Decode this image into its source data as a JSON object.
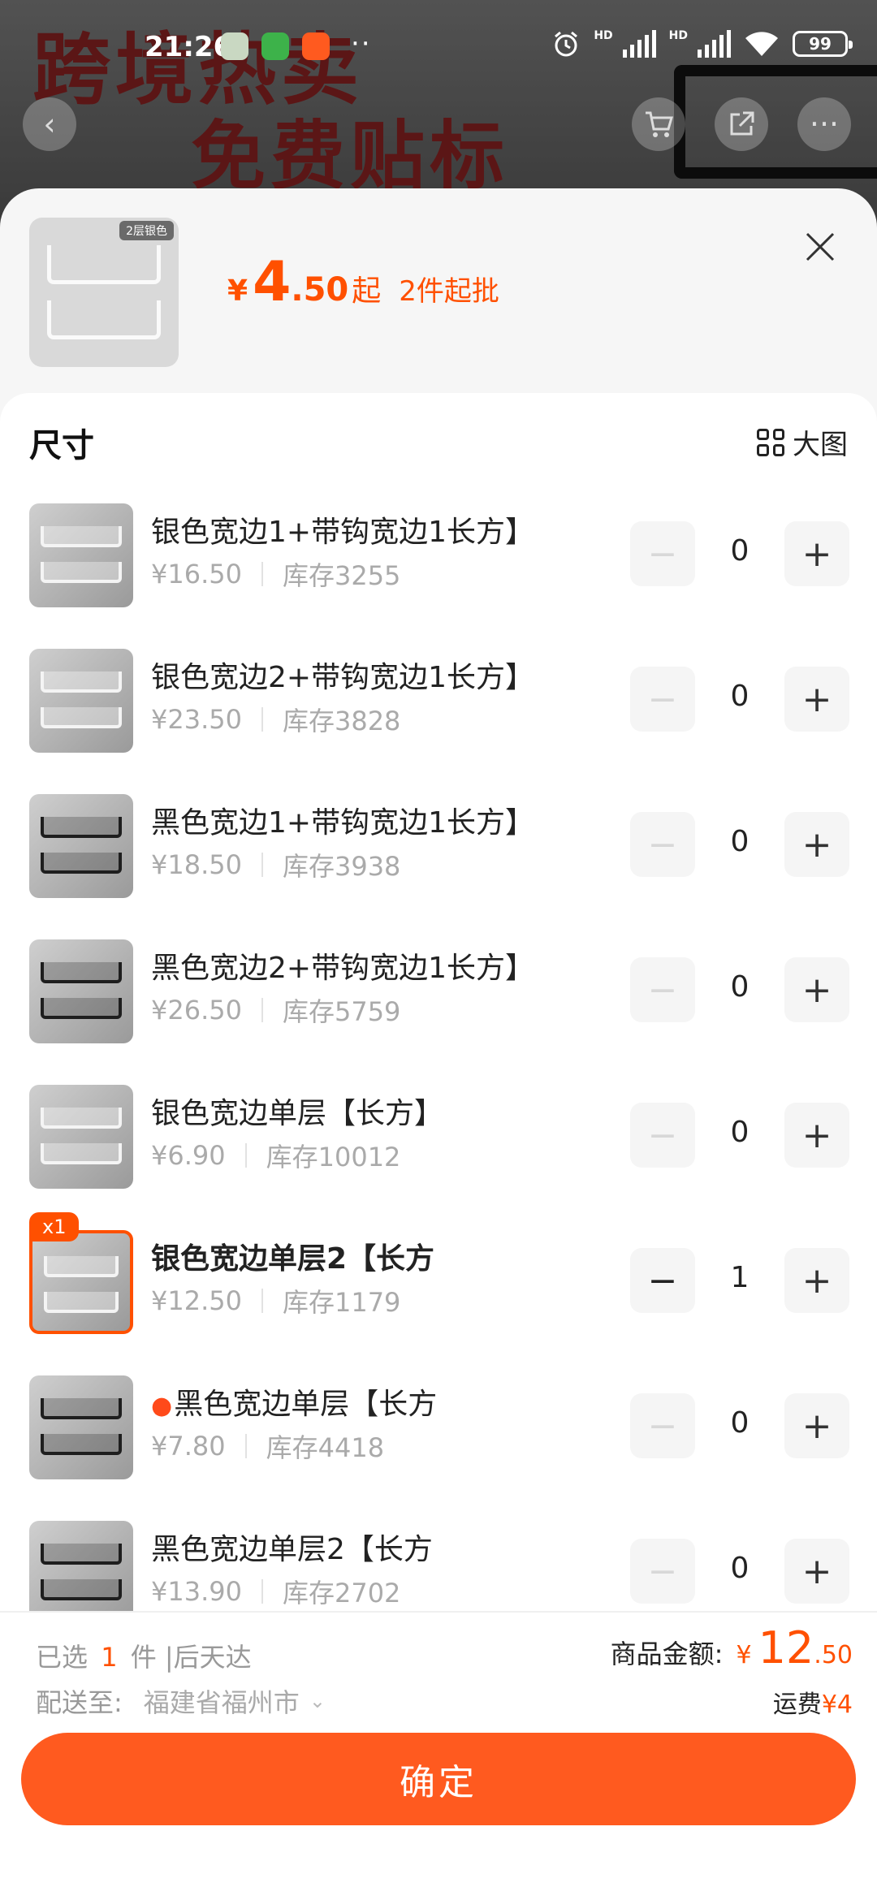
{
  "status_bar": {
    "time": "21:26",
    "battery": "99"
  },
  "background": {
    "banner_line1": "跨境热卖",
    "banner_line2": "免费贴标"
  },
  "sheet": {
    "main_image_tag": "2层银色",
    "price": {
      "currency": "¥",
      "integer": "4",
      "decimal": ".50",
      "suffix": "起",
      "moq": "2件起批"
    }
  },
  "size_section": {
    "title": "尺寸",
    "big_image_label": "大图"
  },
  "skus": [
    {
      "name": "银色宽边1+带钩宽边1长方】",
      "price": "¥16.50",
      "stock": "库存3255",
      "qty": "0",
      "color": "silver",
      "selected": false
    },
    {
      "name": "银色宽边2+带钩宽边1长方】",
      "price": "¥23.50",
      "stock": "库存3828",
      "qty": "0",
      "color": "silver",
      "selected": false
    },
    {
      "name": "黑色宽边1+带钩宽边1长方】",
      "price": "¥18.50",
      "stock": "库存3938",
      "qty": "0",
      "color": "black",
      "selected": false
    },
    {
      "name": "黑色宽边2+带钩宽边1长方】",
      "price": "¥26.50",
      "stock": "库存5759",
      "qty": "0",
      "color": "black",
      "selected": false
    },
    {
      "name": "银色宽边单层【长方】",
      "price": "¥6.90",
      "stock": "库存10012",
      "qty": "0",
      "color": "silver",
      "selected": false
    },
    {
      "name": "银色宽边单层2【长方",
      "price": "¥12.50",
      "stock": "库存1179",
      "qty": "1",
      "color": "silver",
      "selected": true,
      "badge": "x1"
    },
    {
      "name": "黑色宽边单层【长方",
      "price": "¥7.80",
      "stock": "库存4418",
      "qty": "0",
      "color": "black",
      "selected": false,
      "hot": true
    },
    {
      "name": "黑色宽边单层2【长方",
      "price": "¥13.90",
      "stock": "库存2702",
      "qty": "0",
      "color": "black",
      "selected": false
    }
  ],
  "footer": {
    "selected_prefix": "已选",
    "selected_count": "1",
    "selected_suffix": "件 |后天达",
    "ship_label": "配送至:",
    "ship_address": "福建省福州市",
    "amount_label": "商品金额:",
    "amount_currency": "¥",
    "amount_integer": "12",
    "amount_decimal": ".50",
    "fee_label": "运费",
    "fee_value": "¥4",
    "confirm_label": "确定"
  },
  "colors": {
    "accent": "#ff5000",
    "button": "#ff5a1f"
  }
}
